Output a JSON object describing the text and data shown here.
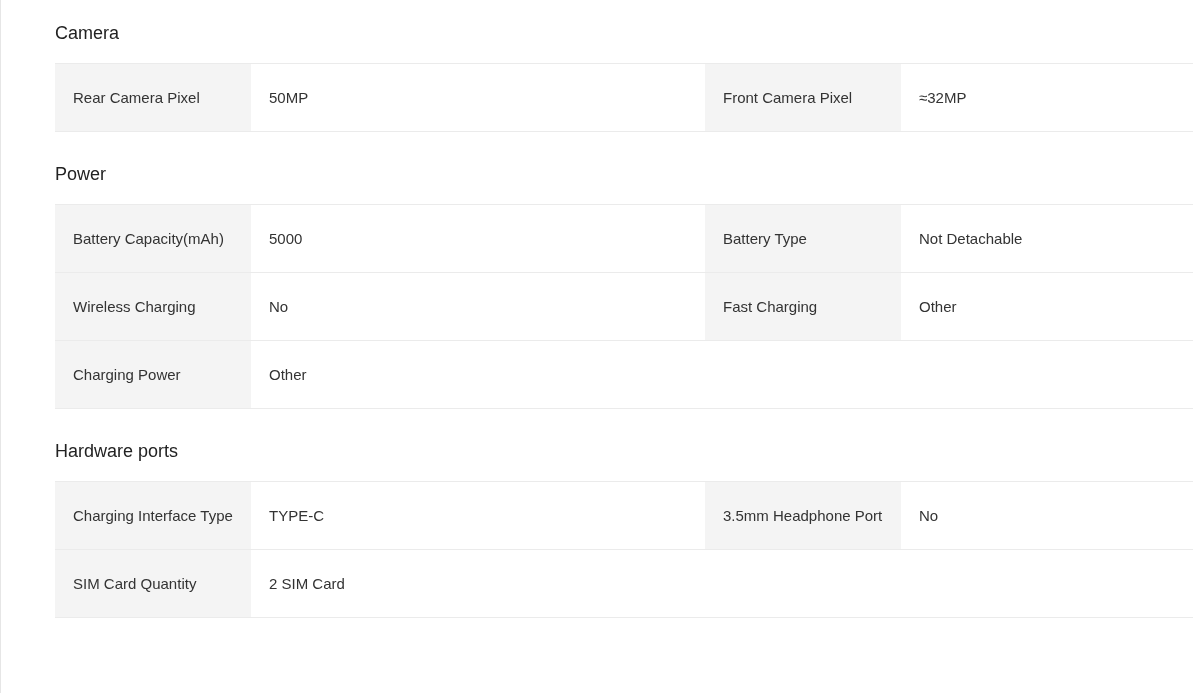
{
  "sections": [
    {
      "title": "Camera",
      "rows": [
        {
          "pairs": [
            {
              "label": "Rear Camera Pixel",
              "value": "50MP"
            },
            {
              "label": "Front Camera Pixel",
              "value": "≈32MP"
            }
          ]
        }
      ]
    },
    {
      "title": "Power",
      "rows": [
        {
          "pairs": [
            {
              "label": "Battery Capacity(mAh)",
              "value": "5000"
            },
            {
              "label": "Battery Type",
              "value": "Not Detachable"
            }
          ]
        },
        {
          "pairs": [
            {
              "label": "Wireless Charging",
              "value": "No"
            },
            {
              "label": "Fast Charging",
              "value": "Other"
            }
          ]
        },
        {
          "pairs": [
            {
              "label": "Charging Power",
              "value": "Other"
            }
          ]
        }
      ]
    },
    {
      "title": "Hardware ports",
      "rows": [
        {
          "pairs": [
            {
              "label": "Charging Interface Type",
              "value": "TYPE-C"
            },
            {
              "label": "3.5mm Headphone Port",
              "value": "No"
            }
          ]
        },
        {
          "pairs": [
            {
              "label": "SIM Card Quantity",
              "value": "2 SIM Card"
            }
          ]
        }
      ]
    }
  ]
}
